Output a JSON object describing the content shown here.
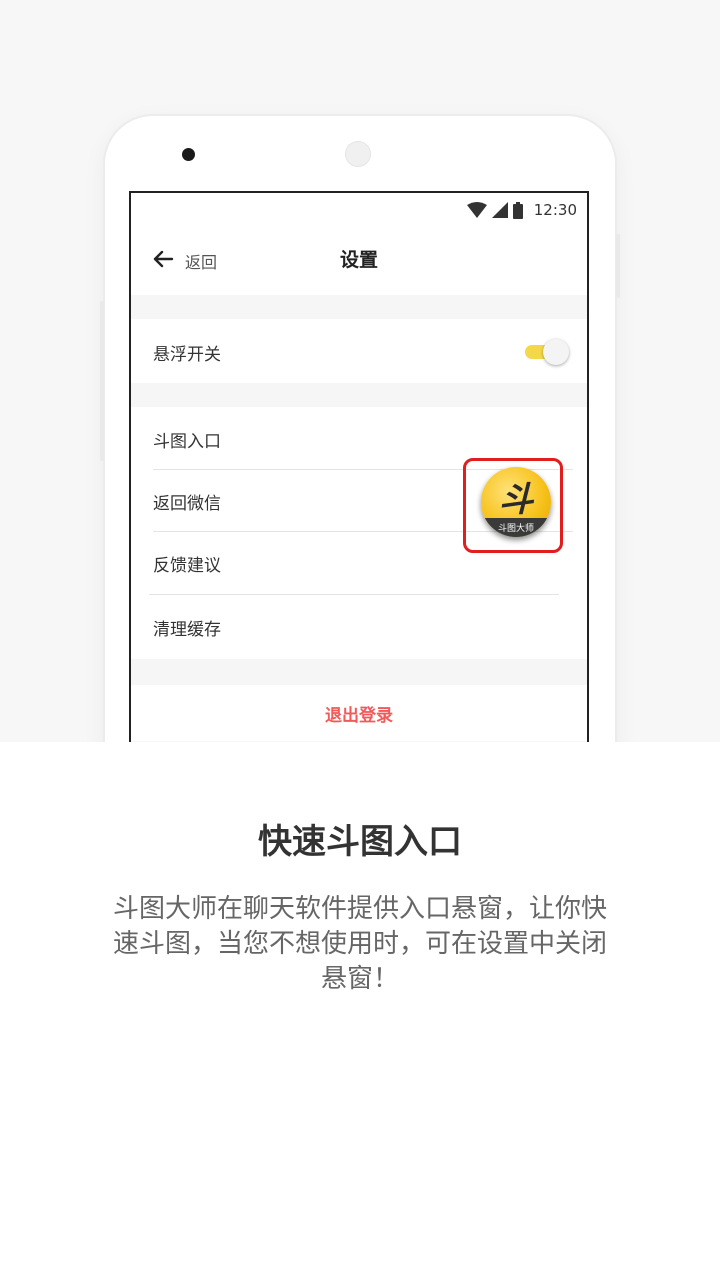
{
  "status_bar": {
    "time": "12:30"
  },
  "header": {
    "back_label": "返回",
    "title": "设置"
  },
  "settings": {
    "float_switch": {
      "label": "悬浮开关",
      "enabled": true
    },
    "items": [
      {
        "label": "斗图入口"
      },
      {
        "label": "返回微信"
      },
      {
        "label": "反馈建议"
      },
      {
        "label": "清理缓存"
      }
    ],
    "logout_label": "退出登录"
  },
  "float_ball": {
    "glyph": "斗",
    "caption": "斗图大师"
  },
  "promo": {
    "headline": "快速斗图入口",
    "description": "斗图大师在聊天软件提供入口悬窗，让你快速斗图，当您不想使用时，可在设置中关闭悬窗！"
  },
  "colors": {
    "accent_yellow": "#f5d84a",
    "logout_red": "#f25a5a",
    "highlight_red": "#e11d1d"
  }
}
